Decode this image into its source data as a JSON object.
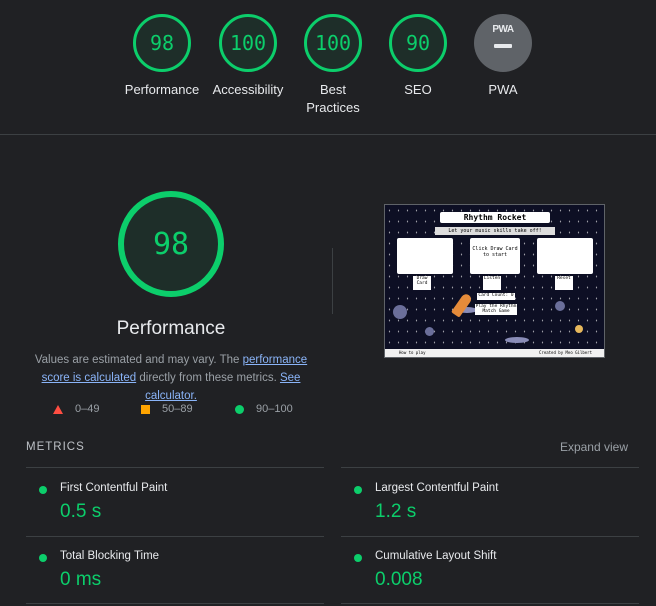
{
  "colors": {
    "pass": "#0cce6b",
    "average": "#ffa400",
    "fail": "#ff4e42",
    "link": "#8ab4f8",
    "background": "#202124"
  },
  "gauges": [
    {
      "score": "98",
      "label": "Performance"
    },
    {
      "score": "100",
      "label": "Accessibility"
    },
    {
      "score": "100",
      "label": "Best Practices"
    },
    {
      "score": "90",
      "label": "SEO"
    }
  ],
  "pwa": {
    "badge": "PWA",
    "label": "PWA"
  },
  "main": {
    "score": "98",
    "title": "Performance",
    "desc_pre": "Values are estimated and may vary. The ",
    "desc_link1": "performance score is calculated",
    "desc_mid": " directly from these metrics. ",
    "desc_link2": "See calculator."
  },
  "legend": {
    "fail": "0–49",
    "average": "50–89",
    "pass": "90–100"
  },
  "screenshot": {
    "title": "Rhythm Rocket",
    "subtitle": "Let your music skills take off!",
    "card_text": "Click Draw Card to start",
    "buttons": [
      "Draw Card",
      "Listen",
      "Reset"
    ],
    "card_count": "Card Count: 0",
    "play_text": "Play the Rhythm Match Game",
    "footer_left": "How to play",
    "footer_right": "Created by Meo Gilbert"
  },
  "metrics": {
    "heading": "METRICS",
    "expand": "Expand view",
    "items": [
      {
        "name": "First Contentful Paint",
        "value": "0.5 s"
      },
      {
        "name": "Largest Contentful Paint",
        "value": "1.2 s"
      },
      {
        "name": "Total Blocking Time",
        "value": "0 ms"
      },
      {
        "name": "Cumulative Layout Shift",
        "value": "0.008"
      }
    ]
  }
}
